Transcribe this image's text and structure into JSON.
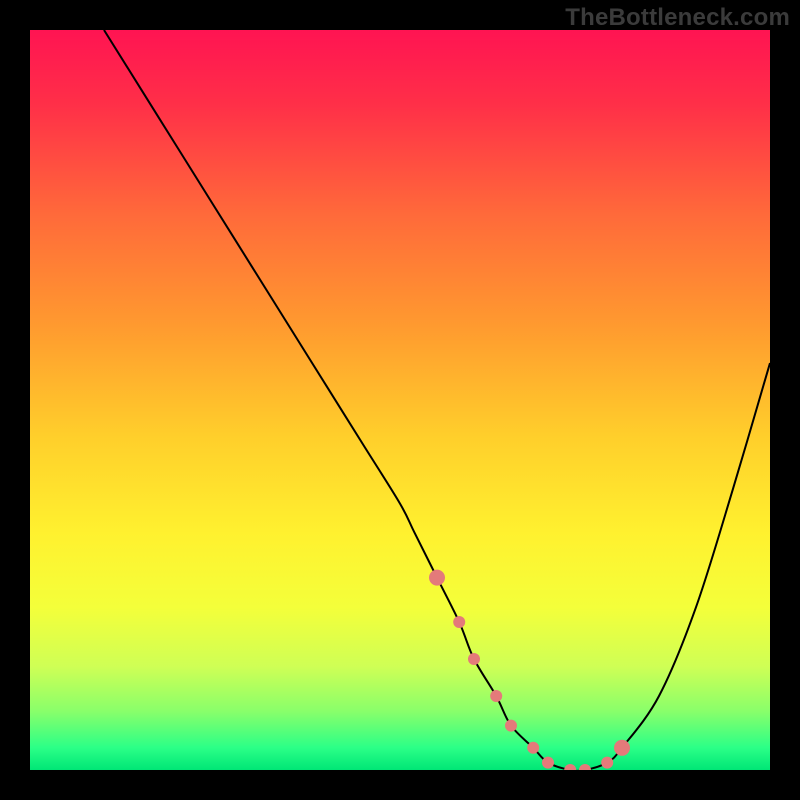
{
  "watermark": "TheBottleneck.com",
  "chart_data": {
    "type": "line",
    "title": "",
    "xlabel": "",
    "ylabel": "",
    "xlim": [
      0,
      100
    ],
    "ylim": [
      0,
      100
    ],
    "grid": false,
    "legend": false,
    "series": [
      {
        "name": "curve",
        "color": "#000000",
        "x": [
          10,
          15,
          20,
          25,
          30,
          35,
          40,
          45,
          50,
          52,
          55,
          58,
          60,
          63,
          65,
          68,
          70,
          73,
          75,
          78,
          80,
          85,
          90,
          95,
          100
        ],
        "y": [
          100,
          92,
          84,
          76,
          68,
          60,
          52,
          44,
          36,
          32,
          26,
          20,
          15,
          10,
          6,
          3,
          1,
          0,
          0,
          1,
          3,
          10,
          22,
          38,
          55
        ]
      }
    ],
    "highlight": {
      "name": "highlight-dots",
      "color": "#e47a7a",
      "x": [
        55,
        58,
        60,
        63,
        65,
        68,
        70,
        73,
        75,
        78,
        80
      ],
      "y": [
        26,
        20,
        15,
        10,
        6,
        3,
        1,
        0,
        0,
        1,
        3
      ]
    },
    "gradient_stops": [
      {
        "offset": 0.0,
        "color": "#ff1452"
      },
      {
        "offset": 0.1,
        "color": "#ff2f48"
      },
      {
        "offset": 0.25,
        "color": "#ff6a3a"
      },
      {
        "offset": 0.4,
        "color": "#ff9a2f"
      },
      {
        "offset": 0.55,
        "color": "#ffcf2b"
      },
      {
        "offset": 0.68,
        "color": "#fff12f"
      },
      {
        "offset": 0.78,
        "color": "#f4ff3a"
      },
      {
        "offset": 0.86,
        "color": "#cfff55"
      },
      {
        "offset": 0.92,
        "color": "#8aff6a"
      },
      {
        "offset": 0.97,
        "color": "#2bff87"
      },
      {
        "offset": 1.0,
        "color": "#00e676"
      }
    ]
  }
}
